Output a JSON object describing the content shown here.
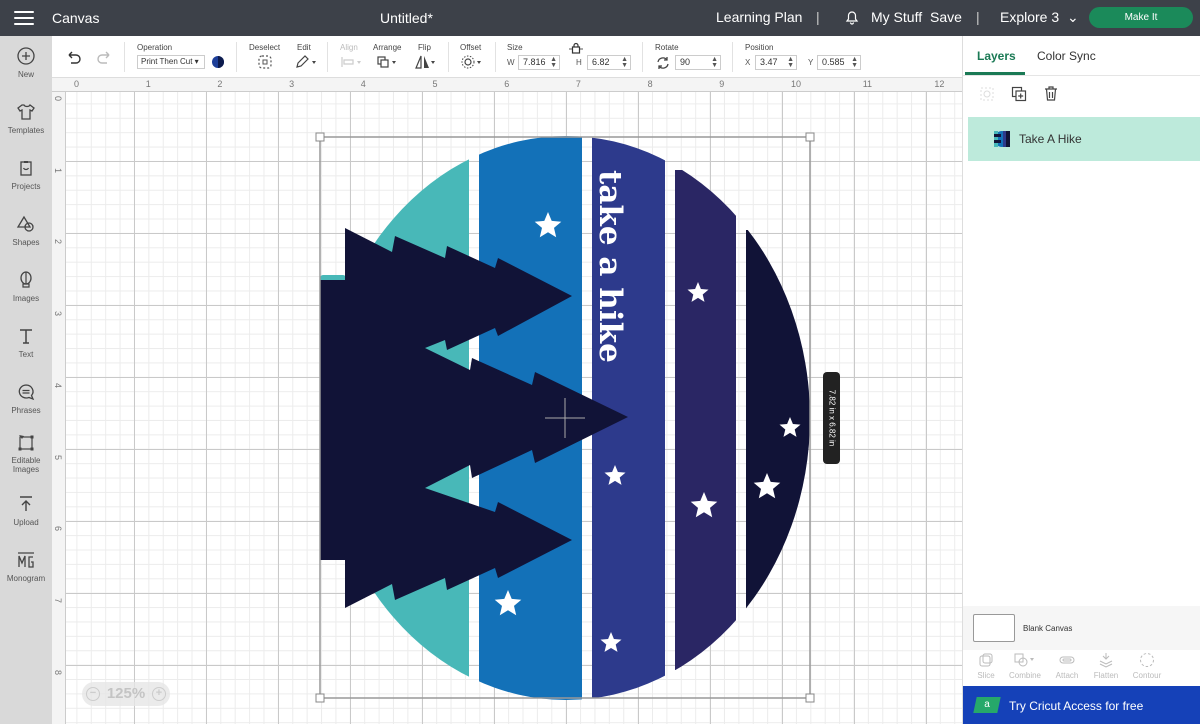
{
  "topbar": {
    "app_section": "Canvas",
    "document_title": "Untitled*",
    "learning_plan": "Learning Plan",
    "separator": "|",
    "my_stuff": "My Stuff",
    "save": "Save",
    "machine": "Explore 3",
    "make_it": "Make It"
  },
  "sidebar": {
    "items": [
      {
        "label": "New",
        "icon": "plus-circle-icon"
      },
      {
        "label": "Templates",
        "icon": "tshirt-icon"
      },
      {
        "label": "Projects",
        "icon": "projects-icon"
      },
      {
        "label": "Shapes",
        "icon": "shapes-icon"
      },
      {
        "label": "Images",
        "icon": "balloon-icon"
      },
      {
        "label": "Text",
        "icon": "text-icon"
      },
      {
        "label": "Phrases",
        "icon": "speech-bubble-icon"
      },
      {
        "label": "Editable",
        "label2": "Images",
        "icon": "editable-images-icon"
      },
      {
        "label": "Upload",
        "icon": "upload-icon"
      },
      {
        "label": "Monogram",
        "icon": "monogram-icon"
      }
    ]
  },
  "toolbar": {
    "operation_label": "Operation",
    "operation_value": "Print Then Cut ▾",
    "deselect_label": "Deselect",
    "edit_label": "Edit",
    "align_label": "Align",
    "arrange_label": "Arrange",
    "flip_label": "Flip",
    "offset_label": "Offset",
    "size_label": "Size",
    "w_label": "W",
    "w_value": "7.816",
    "h_label": "H",
    "h_value": "6.82",
    "rotate_label": "Rotate",
    "rotate_value": "90",
    "position_label": "Position",
    "x_label": "X",
    "x_value": "3.47",
    "y_label": "Y",
    "y_value": "0.585"
  },
  "canvas": {
    "ruler_top": [
      "0",
      "1",
      "2",
      "3",
      "4",
      "5",
      "6",
      "7",
      "8",
      "9",
      "10",
      "11",
      "12"
    ],
    "ruler_left": [
      "0",
      "1",
      "2",
      "3",
      "4",
      "5",
      "6",
      "7",
      "8"
    ],
    "zoom_level": "125%",
    "size_tooltip": "7.82  in x 6.82  in",
    "design_text": "take a hike",
    "colors": {
      "teal": "#48b8b8",
      "blue": "#1371b8",
      "indigo": "#2d3a8c",
      "purple": "#2a2664",
      "navy": "#111337",
      "star": "#ffffff"
    }
  },
  "panel": {
    "tabs": [
      {
        "label": "Layers",
        "active": true
      },
      {
        "label": "Color Sync",
        "active": false
      }
    ],
    "layers": [
      {
        "name": "Take A Hike",
        "selected": true
      }
    ],
    "blank_canvas": "Blank Canvas",
    "bottom_tools": [
      "Slice",
      "Combine",
      "Attach",
      "Flatten",
      "Contour"
    ],
    "access_banner": "Try Cricut Access for free",
    "access_badge": "a",
    "accent_color": "#1b7a55"
  }
}
